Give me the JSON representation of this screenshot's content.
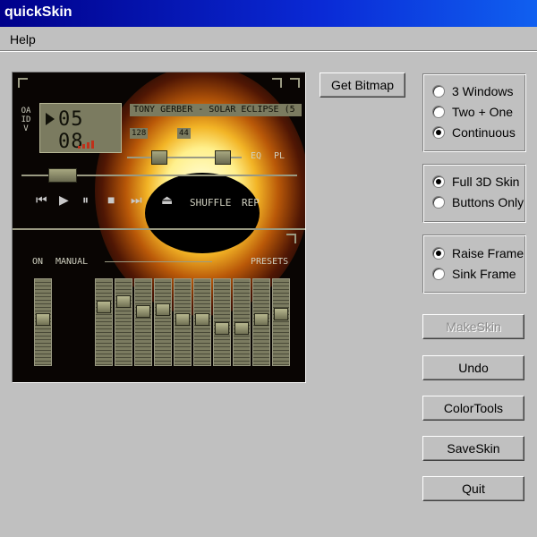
{
  "window": {
    "title": "quickSkin"
  },
  "menu": {
    "items": [
      "Help"
    ]
  },
  "skin_preview": {
    "time": "05 08",
    "ticker": "TONY GERBER - SOLAR ECLIPSE (5",
    "kbps": "128",
    "khz": "44",
    "eq_label": "EQ",
    "pl_label": "PL",
    "shuffle_label": "SHUFFLE",
    "rep_label": "REP",
    "on_label": "ON",
    "manual_label": "MANUAL",
    "presets_label": "PRESETS",
    "side_letters": "OAIDV",
    "eq_levels": [
      0.48,
      0.3,
      0.22,
      0.36,
      0.34,
      0.48,
      0.48,
      0.6,
      0.6,
      0.48,
      0.4,
      0.48
    ]
  },
  "buttons": {
    "get_bitmap": "Get Bitmap",
    "make_skin": "MakeSkin",
    "undo": "Undo",
    "color_tools": "ColorTools",
    "save_skin": "SaveSkin",
    "quit": "Quit"
  },
  "window_mode": {
    "options": [
      "3 Windows",
      "Two + One",
      "Continuous"
    ],
    "selected": "Continuous"
  },
  "skin_mode": {
    "options": [
      "Full 3D Skin",
      "Buttons Only"
    ],
    "selected": "Full 3D Skin"
  },
  "frame_mode": {
    "options": [
      "Raise Frame",
      "Sink Frame"
    ],
    "selected": "Raise Frame"
  }
}
